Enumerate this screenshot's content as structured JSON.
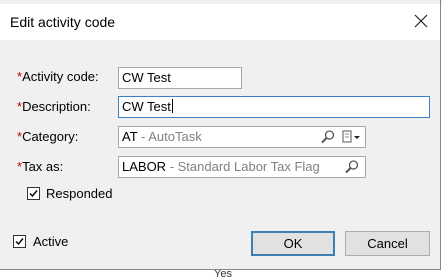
{
  "dialog": {
    "title": "Edit activity code"
  },
  "form": {
    "activity_code": {
      "label": "Activity code:",
      "required_mark": "*",
      "value": "CW Test"
    },
    "description": {
      "label": "Description:",
      "required_mark": "*",
      "value": "CW Test"
    },
    "category": {
      "label": "Category:",
      "required_mark": "*",
      "code": "AT",
      "separator": " - ",
      "name": "AutoTask"
    },
    "tax_as": {
      "label": "Tax as:",
      "required_mark": "*",
      "code": "LABOR",
      "separator": " - ",
      "name": "Standard Labor Tax Flag"
    },
    "responded": {
      "label": "Responded",
      "checked": true
    },
    "active": {
      "label": "Active",
      "checked": true
    }
  },
  "buttons": {
    "ok": "OK",
    "cancel": "Cancel"
  },
  "background_text": "Yes",
  "colors": {
    "required": "#c00000",
    "focus_border": "#3b80c9",
    "secondary_text": "#808080"
  },
  "icons": [
    "close-icon",
    "search-icon",
    "dropdown-icon",
    "checkmark-icon"
  ]
}
